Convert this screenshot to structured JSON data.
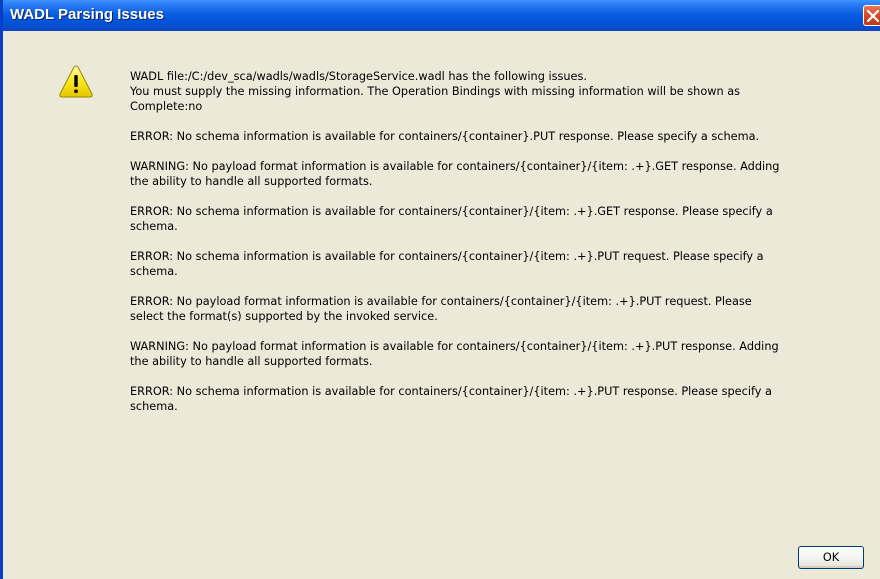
{
  "window": {
    "title": "WADL Parsing Issues",
    "close_icon": "close-icon",
    "colors": {
      "titlebar": "#0a5ee0",
      "body": "#ece9d8",
      "close": "#d44a25"
    }
  },
  "icon": {
    "name": "warning-icon",
    "color": "#f8e71c"
  },
  "messages": [
    {
      "lines": [
        "WADL file:/C:/dev_sca/wadls/wadls/StorageService.wadl has the following issues.",
        "You must supply the missing information. The Operation Bindings with missing information will be shown as",
        "Complete:no"
      ]
    },
    {
      "lines": [
        "ERROR: No schema information is available for containers/{container}.PUT response.  Please specify a schema."
      ]
    },
    {
      "lines": [
        "WARNING: No payload format information is available for containers/{container}/{item: .+}.GET response. Adding",
        "the ability to handle all supported formats."
      ]
    },
    {
      "lines": [
        "ERROR: No schema information is available for containers/{container}/{item: .+}.GET response.  Please specify a",
        "schema."
      ]
    },
    {
      "lines": [
        "ERROR: No schema information is available for containers/{container}/{item: .+}.PUT request.  Please specify a",
        "schema."
      ]
    },
    {
      "lines": [
        "ERROR: No payload format information is available for containers/{container}/{item: .+}.PUT request. Please",
        "select the format(s) supported by the invoked service."
      ]
    },
    {
      "lines": [
        "WARNING: No payload format information is available for containers/{container}/{item: .+}.PUT response. Adding",
        "the ability to handle all supported formats."
      ]
    },
    {
      "lines": [
        "ERROR: No schema information is available for containers/{container}/{item: .+}.PUT response.  Please specify a",
        "schema."
      ]
    }
  ],
  "buttons": {
    "ok_label": "OK"
  }
}
